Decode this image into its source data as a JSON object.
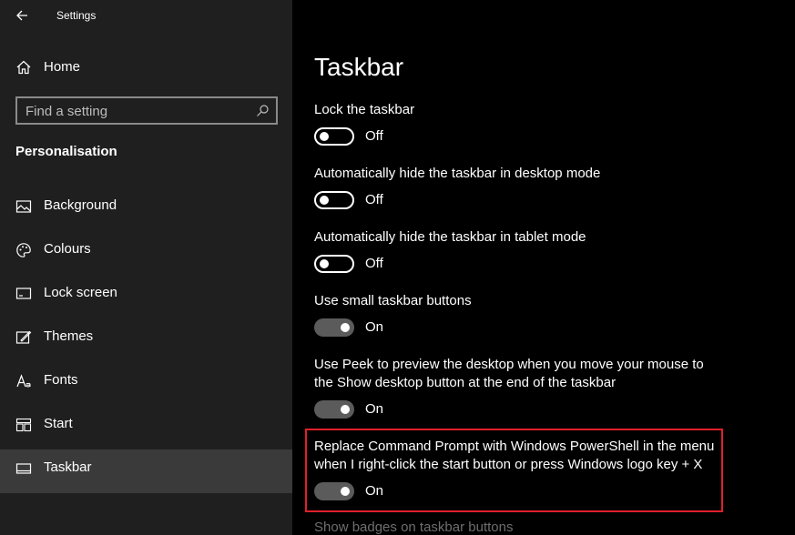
{
  "window": {
    "title": "Settings"
  },
  "sidebar": {
    "home_label": "Home",
    "search_placeholder": "Find a setting",
    "section_title": "Personalisation",
    "items": [
      {
        "label": "Background",
        "icon": "picture-icon"
      },
      {
        "label": "Colours",
        "icon": "palette-icon"
      },
      {
        "label": "Lock screen",
        "icon": "lock-screen-icon"
      },
      {
        "label": "Themes",
        "icon": "themes-icon"
      },
      {
        "label": "Fonts",
        "icon": "fonts-icon"
      },
      {
        "label": "Start",
        "icon": "start-icon"
      },
      {
        "label": "Taskbar",
        "icon": "taskbar-icon",
        "selected": true
      }
    ]
  },
  "main": {
    "title": "Taskbar",
    "settings": [
      {
        "label": "Lock the taskbar",
        "state": "Off"
      },
      {
        "label": "Automatically hide the taskbar in desktop mode",
        "state": "Off"
      },
      {
        "label": "Automatically hide the taskbar in tablet mode",
        "state": "Off"
      },
      {
        "label": "Use small taskbar buttons",
        "state": "On"
      },
      {
        "label": "Use Peek to preview the desktop when you move your mouse to the Show desktop button at the end of the taskbar",
        "state": "On"
      },
      {
        "label": "Replace Command Prompt with Windows PowerShell in the menu when I right-click the start button or press Windows logo key + X",
        "state": "On"
      }
    ],
    "next_setting_label": "Show badges on taskbar buttons"
  },
  "colors": {
    "sidebar_bg": "#1f1f1f",
    "main_bg": "#000000",
    "selected_bg": "#3a3a3a",
    "highlight_border": "#e0202a"
  }
}
